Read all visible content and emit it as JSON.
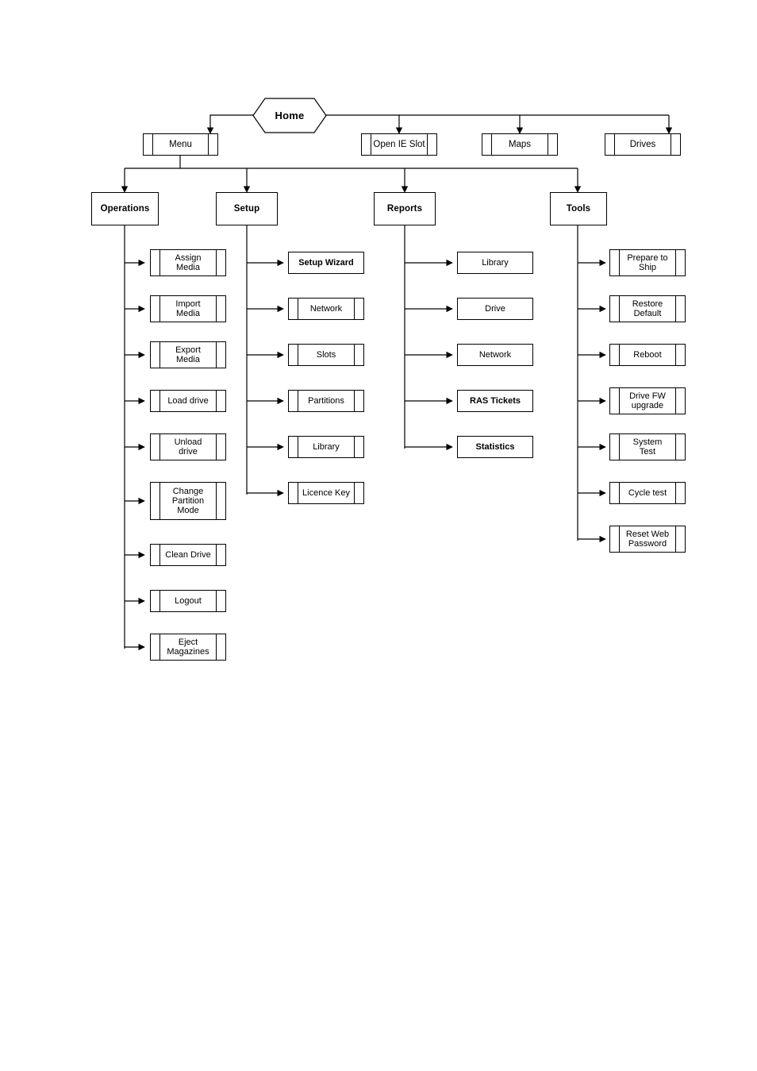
{
  "diagram": {
    "type": "menu-tree",
    "title": "Home",
    "root": {
      "label": "Home",
      "shape": "hexagon"
    },
    "level1": [
      {
        "label": "Menu",
        "shape": "predefined-process"
      },
      {
        "label": "Open IE Slot",
        "shape": "predefined-process"
      },
      {
        "label": "Maps",
        "shape": "predefined-process"
      },
      {
        "label": "Drives",
        "shape": "predefined-process"
      }
    ],
    "categories": [
      {
        "label": "Operations",
        "shape": "process",
        "items": [
          {
            "label": "Assign\nMedia",
            "shape": "predefined-process",
            "bold": false
          },
          {
            "label": "Import\nMedia",
            "shape": "predefined-process",
            "bold": false
          },
          {
            "label": "Export\nMedia",
            "shape": "predefined-process",
            "bold": false
          },
          {
            "label": "Load drive",
            "shape": "predefined-process",
            "bold": false
          },
          {
            "label": "Unload\ndrive",
            "shape": "predefined-process",
            "bold": false
          },
          {
            "label": "Change\nPartition\nMode",
            "shape": "predefined-process",
            "bold": false
          },
          {
            "label": "Clean Drive",
            "shape": "predefined-process",
            "bold": false
          },
          {
            "label": "Logout",
            "shape": "predefined-process",
            "bold": false
          },
          {
            "label": "Eject\nMagazines",
            "shape": "predefined-process",
            "bold": false
          }
        ]
      },
      {
        "label": "Setup",
        "shape": "process",
        "items": [
          {
            "label": "Setup Wizard",
            "shape": "process",
            "bold": true
          },
          {
            "label": "Network",
            "shape": "predefined-process",
            "bold": false
          },
          {
            "label": "Slots",
            "shape": "predefined-process",
            "bold": false
          },
          {
            "label": "Partitions",
            "shape": "predefined-process",
            "bold": false
          },
          {
            "label": "Library",
            "shape": "predefined-process",
            "bold": false
          },
          {
            "label": "Licence Key",
            "shape": "predefined-process",
            "bold": false
          }
        ]
      },
      {
        "label": "Reports",
        "shape": "process",
        "items": [
          {
            "label": "Library",
            "shape": "process",
            "bold": false
          },
          {
            "label": "Drive",
            "shape": "process",
            "bold": false
          },
          {
            "label": "Network",
            "shape": "process",
            "bold": false
          },
          {
            "label": "RAS Tickets",
            "shape": "process",
            "bold": true
          },
          {
            "label": "Statistics",
            "shape": "process",
            "bold": true
          }
        ]
      },
      {
        "label": "Tools",
        "shape": "process",
        "items": [
          {
            "label": "Prepare to\nShip",
            "shape": "predefined-process",
            "bold": false
          },
          {
            "label": "Restore\nDefault",
            "shape": "predefined-process",
            "bold": false
          },
          {
            "label": "Reboot",
            "shape": "predefined-process",
            "bold": false
          },
          {
            "label": "Drive FW\nupgrade",
            "shape": "predefined-process",
            "bold": false
          },
          {
            "label": "System\nTest",
            "shape": "predefined-process",
            "bold": false
          },
          {
            "label": "Cycle test",
            "shape": "predefined-process",
            "bold": false
          },
          {
            "label": "Reset Web\nPassword",
            "shape": "predefined-process",
            "bold": false
          }
        ]
      }
    ],
    "colors": {
      "stroke": "#000000",
      "fill": "#ffffff",
      "text": "#000000",
      "background": "#ffffff"
    }
  }
}
